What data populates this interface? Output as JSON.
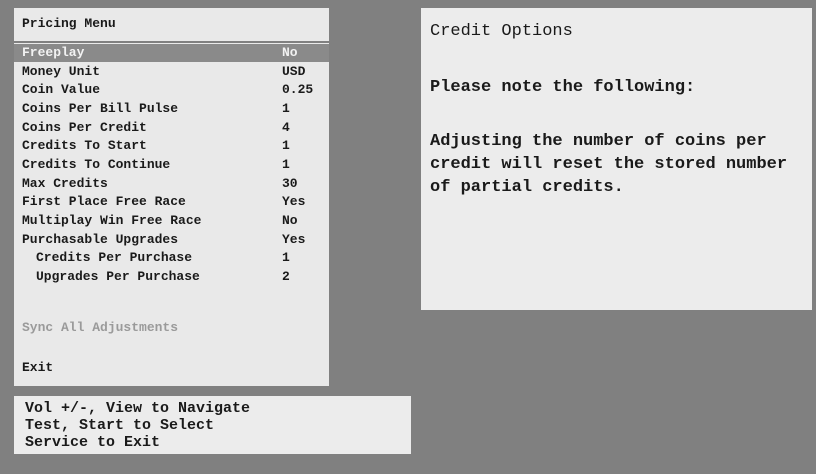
{
  "menu": {
    "title": "Pricing Menu",
    "items": [
      {
        "label": "Freeplay",
        "value": "No"
      },
      {
        "label": "Money Unit",
        "value": "USD"
      },
      {
        "label": "Coin Value",
        "value": "0.25"
      },
      {
        "label": "Coins Per Bill Pulse",
        "value": "1"
      },
      {
        "label": "Coins Per Credit",
        "value": "4"
      },
      {
        "label": "Credits To Start",
        "value": "1"
      },
      {
        "label": "Credits To Continue",
        "value": "1"
      },
      {
        "label": "Max Credits",
        "value": "30"
      },
      {
        "label": "First Place Free Race",
        "value": "Yes"
      },
      {
        "label": "Multiplay Win Free Race",
        "value": "No"
      },
      {
        "label": "Purchasable Upgrades",
        "value": "Yes"
      },
      {
        "label": "Credits Per Purchase",
        "value": "1"
      },
      {
        "label": "Upgrades Per Purchase",
        "value": "2"
      }
    ],
    "sync_label": "Sync All Adjustments",
    "exit_label": "Exit"
  },
  "info": {
    "title": "Credit Options",
    "heading": "Please note the following:",
    "body": "Adjusting the number of coins per credit will reset the stored number of partial credits."
  },
  "help": {
    "line1": "Vol +/-, View to Navigate",
    "line2": "Test, Start to Select",
    "line3": "Service to Exit"
  }
}
